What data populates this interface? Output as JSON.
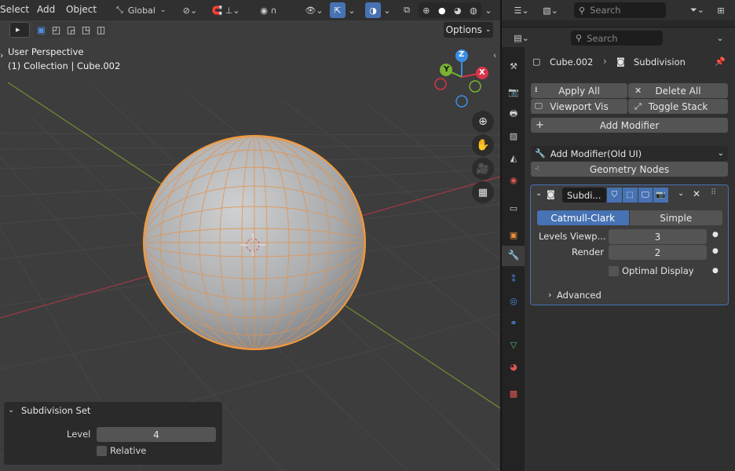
{
  "header": {
    "menus": [
      "Select",
      "Add",
      "Object"
    ],
    "orientation": "Global",
    "search_placeholder": "Search"
  },
  "viewport": {
    "options_label": "Options",
    "perspective": "User Perspective",
    "collection": "(1) Collection | Cube.002",
    "gizmo": {
      "z": "Z",
      "y": "Y",
      "x": "X"
    }
  },
  "operator_panel": {
    "title": "Subdivision Set",
    "level_label": "Level",
    "level_value": "4",
    "relative_label": "Relative"
  },
  "properties": {
    "search_placeholder": "Search",
    "breadcrumb_object": "Cube.002",
    "breadcrumb_modifier": "Subdivision",
    "apply_all": "Apply All",
    "delete_all": "Delete All",
    "viewport_vis": "Viewport Vis",
    "toggle_stack": "Toggle Stack",
    "add_modifier": "Add Modifier",
    "add_modifier_old": "Add Modifier(Old UI)",
    "geometry_nodes": "Geometry Nodes",
    "modifier": {
      "name": "Subdi...",
      "catmull": "Catmull-Clark",
      "simple": "Simple",
      "levels_label": "Levels Viewp...",
      "levels_value": "3",
      "render_label": "Render",
      "render_value": "2",
      "optimal_label": "Optimal Display",
      "advanced_label": "Advanced"
    }
  },
  "colors": {
    "accent": "#4772b3",
    "selection": "#f59a3b",
    "axis_x": "#d8344a",
    "axis_y": "#7bb133",
    "axis_z": "#3a8ee6"
  }
}
